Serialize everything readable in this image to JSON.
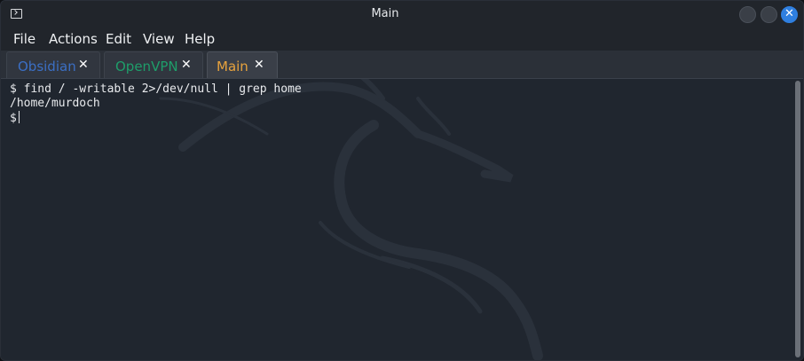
{
  "window": {
    "title": "Main",
    "close_glyph": "✕"
  },
  "menu": [
    "File",
    "Actions",
    "Edit",
    "View",
    "Help"
  ],
  "tabs": [
    {
      "label": "Obsidian",
      "color": "#3b6fc4",
      "close": "✕",
      "active": false
    },
    {
      "label": "OpenVPN",
      "color": "#1e9e6a",
      "close": "✕",
      "active": false
    },
    {
      "label": "Main",
      "color": "#e8a33d",
      "close": "✕",
      "active": true
    }
  ],
  "terminal": {
    "lines": [
      "$ find / -writable 2>/dev/null | grep home",
      "/home/murdoch",
      "$"
    ]
  },
  "colors": {
    "background": "#20262f",
    "text": "#e8eaed",
    "accent": "#2f7fe0"
  }
}
